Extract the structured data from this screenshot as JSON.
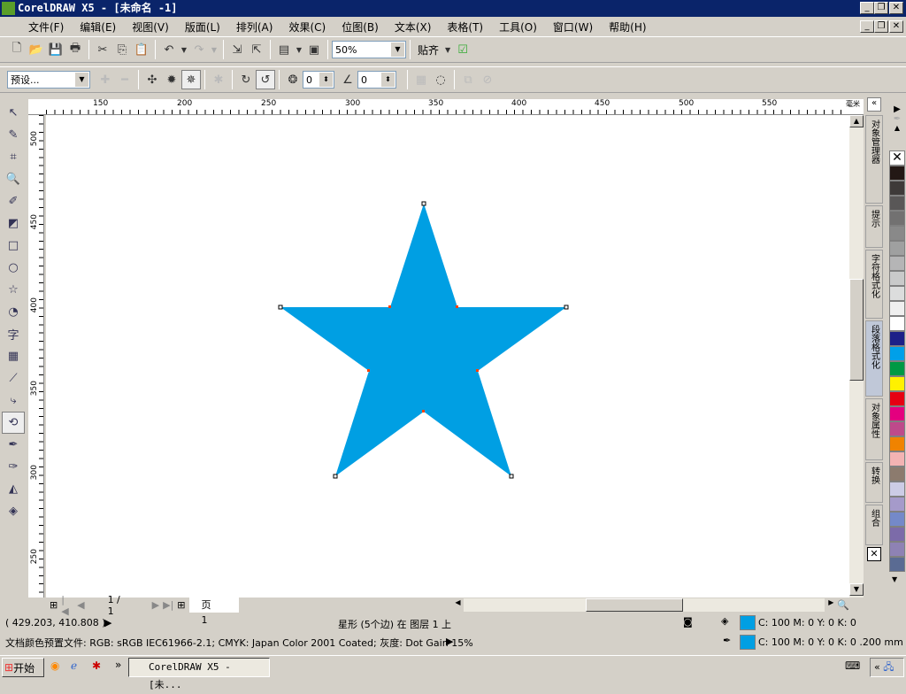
{
  "window": {
    "title": "CorelDRAW X5 - [未命名 -1]"
  },
  "menu": [
    "文件(F)",
    "编辑(E)",
    "视图(V)",
    "版面(L)",
    "排列(A)",
    "效果(C)",
    "位图(B)",
    "文本(X)",
    "表格(T)",
    "工具(O)",
    "窗口(W)",
    "帮助(H)"
  ],
  "toolbar": {
    "zoom": "50%",
    "snap": "贴齐"
  },
  "propbar": {
    "preset": "预设...",
    "points_value": "0",
    "sharpness_value": "0"
  },
  "ruler": {
    "unit": "毫米",
    "top": [
      "150",
      "200",
      "250",
      "300",
      "350",
      "400",
      "450",
      "500",
      "550"
    ],
    "left": [
      "500",
      "450",
      "400",
      "350",
      "300",
      "250"
    ]
  },
  "left_tools": {
    "text_tool": "字"
  },
  "shape": {
    "fill": "#009fe3"
  },
  "pager": {
    "page_count": "1 / 1",
    "tab": "页 1"
  },
  "dockers": [
    "对象管理器",
    "提示",
    "字符格式化",
    "段落格式化",
    "对象属性",
    "转换",
    "组合"
  ],
  "palette": [
    "#231815",
    "#3e3a39",
    "#595757",
    "#727171",
    "#898989",
    "#9fa0a0",
    "#b5b5b6",
    "#c9caca",
    "#dcdddd",
    "#efefef",
    "#ffffff",
    "#1d2088",
    "#00a0e9",
    "#009944",
    "#fff100",
    "#e60012",
    "#e4007f",
    "#be4a8b",
    "#f08300",
    "#f3b3b3",
    "#8c7b6e",
    "#cccce6",
    "#a59aca",
    "#7489c9",
    "#7c6ba9",
    "#8e82b4",
    "#5a6b93"
  ],
  "status": {
    "coords": "( 429.203, 410.808 )",
    "object": "星形 (5个边) 在 图层 1 上",
    "fill": "C: 100 M: 0 Y: 0 K: 0",
    "outline": "C: 100 M: 0 Y: 0 K: 0  .200 mm",
    "profile": "文档颜色预置文件: RGB: sRGB IEC61966-2.1; CMYK: Japan Color 2001 Coated; 灰度: Dot Gain 15%"
  },
  "taskbar": {
    "start": "开始",
    "task": "CorelDRAW X5 - [未..."
  }
}
